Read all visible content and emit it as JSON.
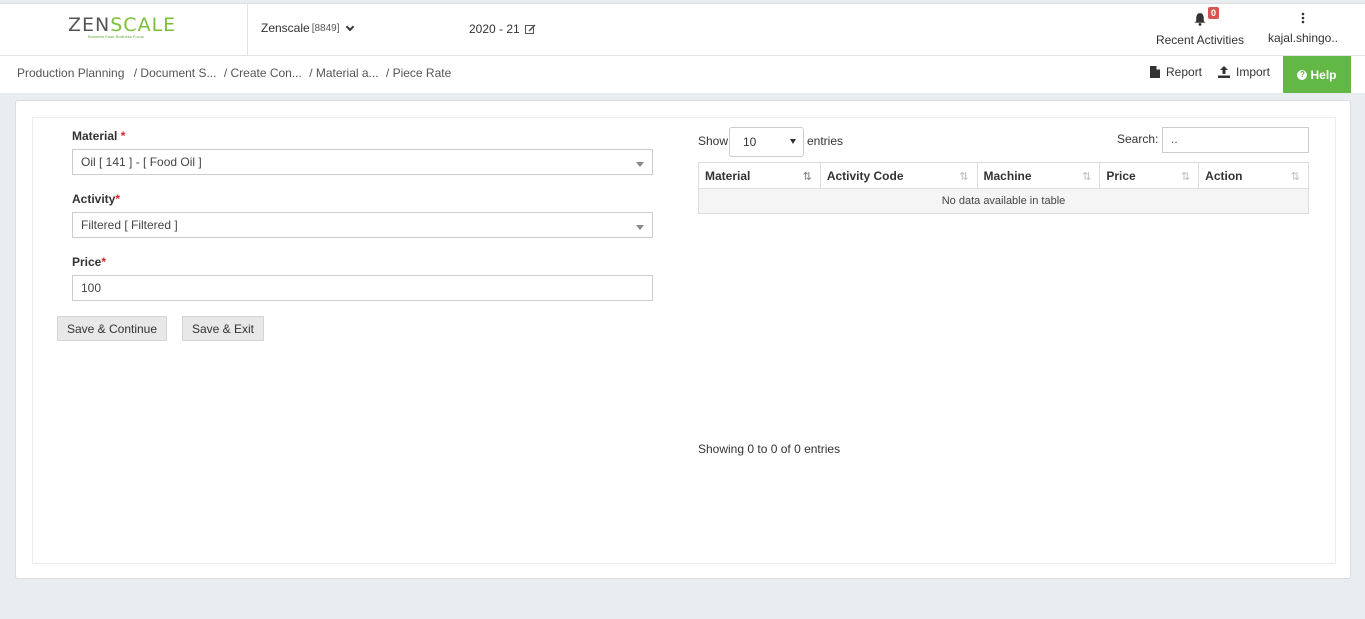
{
  "brand": {
    "logo_text_a": "ZEN",
    "logo_text_b": "SC",
    "logo_text_c": "A",
    "logo_text_d": "LE",
    "tagline": "Business Ease Business Focus",
    "accent_color": "#7bbf3a"
  },
  "header": {
    "company_name": "Zenscale",
    "company_code": "[8849]",
    "financial_year": "2020 - 21",
    "notifications_count": "0",
    "recent_activities_label": "Recent Activities",
    "username": "kajal.shingo.."
  },
  "breadcrumb": {
    "items": [
      "Production Planning",
      "/ Document S...",
      "/ Create Con...",
      "/ Material a...",
      "/ Piece Rate"
    ]
  },
  "toolbar": {
    "report_label": "Report",
    "import_label": "Import",
    "help_label": "Help",
    "help_color": "#62b845"
  },
  "form": {
    "material_label": "Material",
    "material_value": "Oil [ 141 ] - [ Food Oil ]",
    "activity_label": "Activity",
    "activity_value": "Filtered [ Filtered ]",
    "price_label": "Price",
    "price_value": "100",
    "required_mark": "*",
    "save_continue_label": "Save & Continue",
    "save_exit_label": "Save & Exit"
  },
  "table": {
    "show_label": "Show",
    "entries_label": "entries",
    "page_length": "10",
    "search_label": "Search:",
    "search_value": "..",
    "columns": [
      "Material",
      "Activity Code",
      "Machine",
      "Price",
      "Action"
    ],
    "empty_message": "No data available in table",
    "info": "Showing 0 to 0 of 0 entries"
  }
}
